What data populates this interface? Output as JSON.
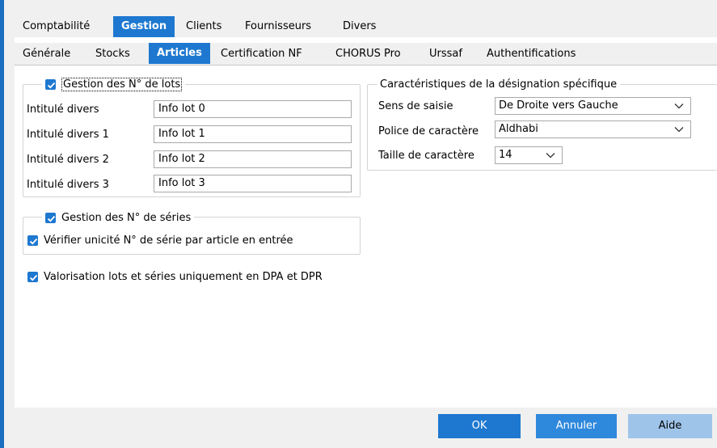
{
  "main_tabs": [
    {
      "label": "Comptabilité",
      "active": false
    },
    {
      "label": "Gestion",
      "active": true
    },
    {
      "label": "Clients",
      "active": false
    },
    {
      "label": "Fournisseurs",
      "active": false
    },
    {
      "label": "Divers",
      "active": false
    }
  ],
  "sub_tabs": [
    {
      "label": "Générale",
      "active": false
    },
    {
      "label": "Stocks",
      "active": false
    },
    {
      "label": "Articles",
      "active": true
    },
    {
      "label": "Certification NF",
      "active": false
    },
    {
      "label": "CHORUS Pro",
      "active": false
    },
    {
      "label": "Urssaf",
      "active": false
    },
    {
      "label": "Authentifications",
      "active": false
    }
  ],
  "lots": {
    "checkbox_label": "Gestion des N° de lots",
    "checked": true,
    "rows": [
      {
        "label": "Intitulé divers",
        "value": "Info lot 0"
      },
      {
        "label": "Intitulé divers 1",
        "value": "Info lot 1"
      },
      {
        "label": "Intitulé divers 2",
        "value": "Info lot 2"
      },
      {
        "label": "Intitulé divers 3",
        "value": "Info lot 3"
      }
    ]
  },
  "series": {
    "checkbox_label": "Gestion des N° de séries",
    "checked": true,
    "verify_label": "Vérifier unicité N° de série par article en entrée",
    "verify_checked": true
  },
  "valorisation": {
    "label": "Valorisation lots et séries uniquement en DPA et DPR",
    "checked": true
  },
  "designation": {
    "title": "Caractéristiques de la désignation spécifique",
    "sens_label": "Sens de saisie",
    "sens_value": "De Droite vers Gauche",
    "police_label": "Police de caractère",
    "police_value": "Aldhabi",
    "taille_label": "Taille de caractère",
    "taille_value": "14"
  },
  "buttons": {
    "ok": "OK",
    "annuler": "Annuler",
    "aide": "Aide"
  },
  "colors": {
    "accent": "#1e78d0",
    "panel_bg": "#ffffff",
    "window_bg": "#f0f0f0"
  }
}
